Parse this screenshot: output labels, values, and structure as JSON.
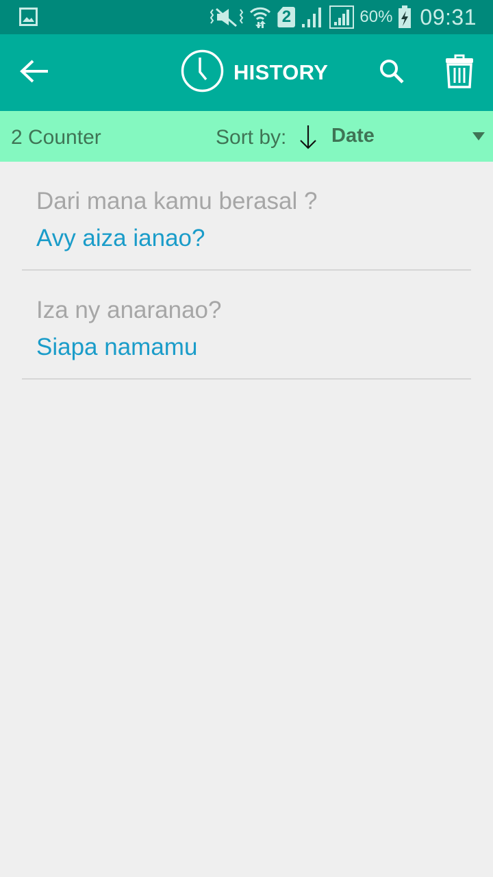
{
  "status_bar": {
    "left_icon": "gallery-notification-icon",
    "icons": [
      "mute-vibrate-icon",
      "wifi-data-icon",
      "sim-2-icon",
      "signal-icon",
      "signal-sim-icon"
    ],
    "sim_number": "2",
    "battery_percent": "60%",
    "battery_icon": "battery-charging-icon",
    "time": "09:31"
  },
  "app_bar": {
    "back_icon": "arrow-left-icon",
    "title_icon": "clock-icon",
    "title": "HISTORY",
    "search_icon": "search-icon",
    "delete_icon": "trash-icon",
    "colors": {
      "background": "#00ad9a",
      "status_bar": "#00897b",
      "foreground": "#ffffff"
    }
  },
  "sort_bar": {
    "counter": "2 Counter",
    "sort_label": "Sort by:",
    "sort_direction": "descending",
    "sort_direction_icon": "arrow-down-icon",
    "sort_value": "Date",
    "dropdown_icon": "caret-down-icon",
    "colors": {
      "background": "#84f8c0",
      "text": "#3f7455"
    }
  },
  "history": {
    "colors": {
      "source_text": "#a6a6a6",
      "translation_text": "#1a9cc9",
      "divider": "#d6d6d6"
    },
    "items": [
      {
        "source": "Dari mana kamu berasal ?",
        "translation": "Avy aiza ianao?"
      },
      {
        "source": "Iza ny anaranao?",
        "translation": "Siapa namamu"
      }
    ]
  }
}
